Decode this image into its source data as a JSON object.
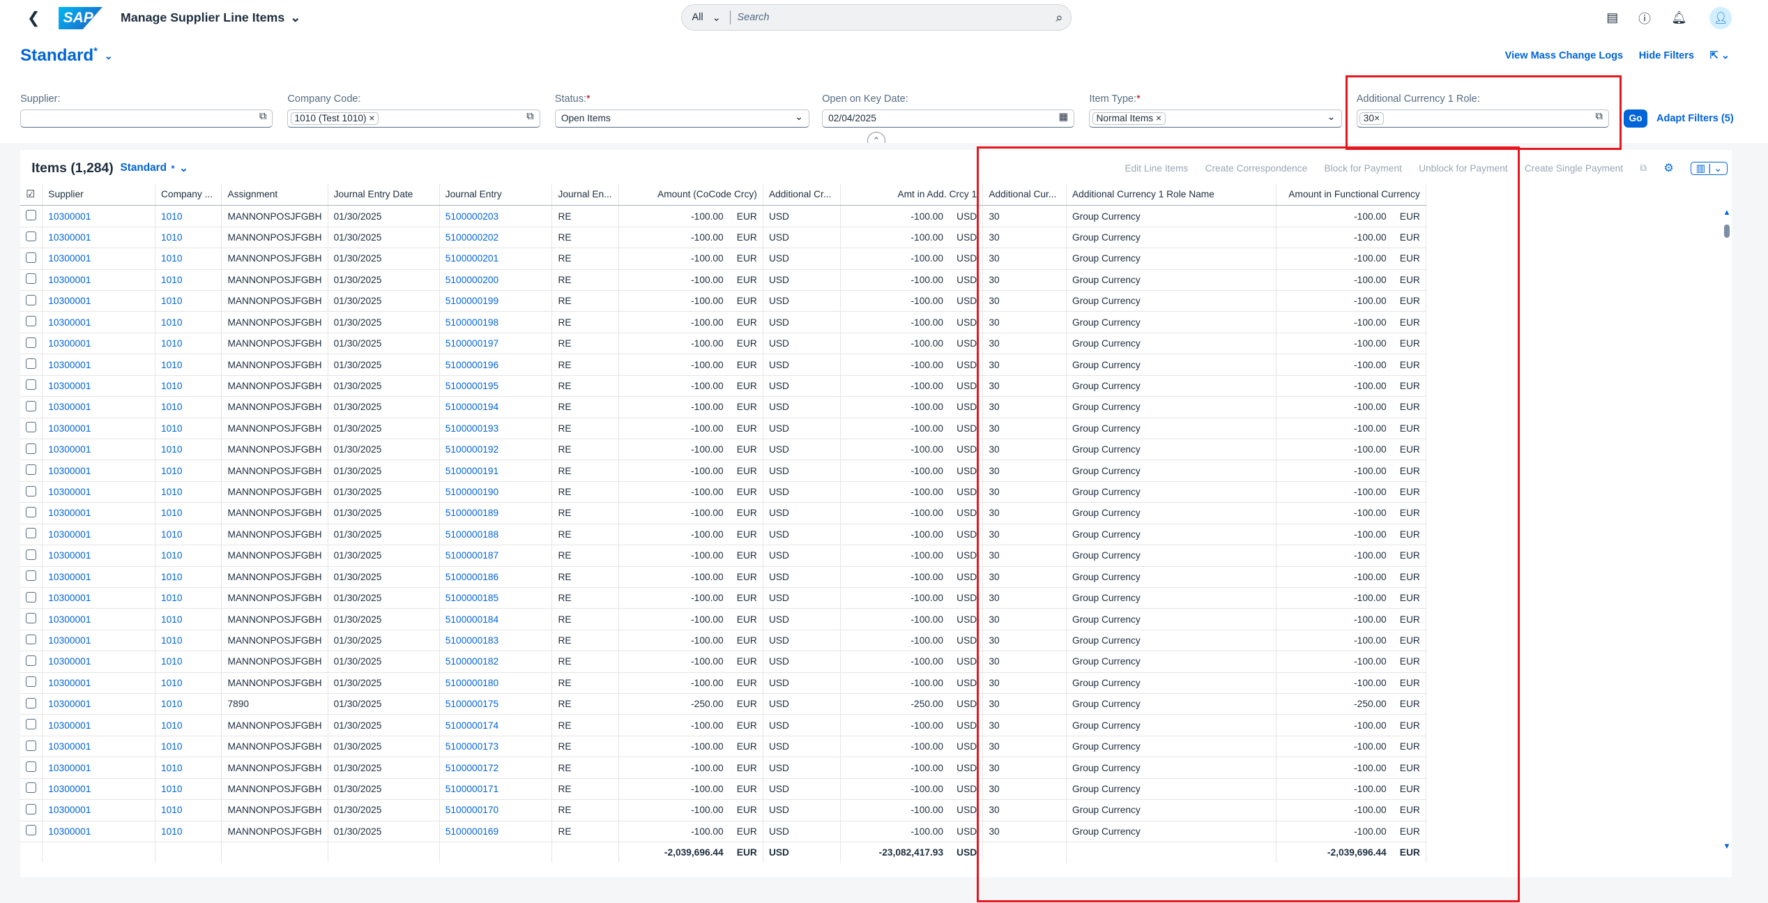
{
  "shell": {
    "app_title": "Manage Supplier Line Items",
    "search_scope": "All",
    "search_placeholder": "Search"
  },
  "page": {
    "variant": "Standard",
    "variant_marker": "*",
    "view_mass_change_logs": "View Mass Change Logs",
    "hide_filters": "Hide Filters"
  },
  "filters": {
    "supplier": {
      "label": "Supplier:",
      "value": ""
    },
    "company_code": {
      "label": "Company Code:",
      "token": "1010 (Test 1010)"
    },
    "status": {
      "label": "Status:",
      "required": "*",
      "value": "Open Items"
    },
    "open_on_key_date": {
      "label": "Open on Key Date:",
      "value": "02/04/2025"
    },
    "item_type": {
      "label": "Item Type:",
      "required": "*",
      "token": "Normal Items"
    },
    "add_currency_role": {
      "label": "Additional Currency 1 Role:",
      "token": "30"
    },
    "go": "Go",
    "adapt": "Adapt Filters (5)"
  },
  "table": {
    "title": "Items (1,284)",
    "variant": "Standard",
    "actions": [
      "Edit Line Items",
      "Create Correspondence",
      "Block for Payment",
      "Unblock for Payment",
      "Create Single Payment"
    ],
    "columns": [
      "Supplier",
      "Company ...",
      "Assignment",
      "Journal Entry Date",
      "Journal Entry",
      "Journal En...",
      "Amount (CoCode Crcy)",
      "Additional Cr...",
      "Amt in Add. Crcy 1",
      "Additional Cur...",
      "Additional Currency 1 Role Name",
      "Amount in Functional Currency"
    ],
    "rows": [
      [
        "10300001",
        "1010",
        "MANNONPOSJFGBH",
        "01/30/2025",
        "5100000203",
        "RE",
        "-100.00",
        "EUR",
        "USD",
        "-100.00",
        "USD",
        "30",
        "Group Currency",
        "-100.00",
        "EUR"
      ],
      [
        "10300001",
        "1010",
        "MANNONPOSJFGBH",
        "01/30/2025",
        "5100000202",
        "RE",
        "-100.00",
        "EUR",
        "USD",
        "-100.00",
        "USD",
        "30",
        "Group Currency",
        "-100.00",
        "EUR"
      ],
      [
        "10300001",
        "1010",
        "MANNONPOSJFGBH",
        "01/30/2025",
        "5100000201",
        "RE",
        "-100.00",
        "EUR",
        "USD",
        "-100.00",
        "USD",
        "30",
        "Group Currency",
        "-100.00",
        "EUR"
      ],
      [
        "10300001",
        "1010",
        "MANNONPOSJFGBH",
        "01/30/2025",
        "5100000200",
        "RE",
        "-100.00",
        "EUR",
        "USD",
        "-100.00",
        "USD",
        "30",
        "Group Currency",
        "-100.00",
        "EUR"
      ],
      [
        "10300001",
        "1010",
        "MANNONPOSJFGBH",
        "01/30/2025",
        "5100000199",
        "RE",
        "-100.00",
        "EUR",
        "USD",
        "-100.00",
        "USD",
        "30",
        "Group Currency",
        "-100.00",
        "EUR"
      ],
      [
        "10300001",
        "1010",
        "MANNONPOSJFGBH",
        "01/30/2025",
        "5100000198",
        "RE",
        "-100.00",
        "EUR",
        "USD",
        "-100.00",
        "USD",
        "30",
        "Group Currency",
        "-100.00",
        "EUR"
      ],
      [
        "10300001",
        "1010",
        "MANNONPOSJFGBH",
        "01/30/2025",
        "5100000197",
        "RE",
        "-100.00",
        "EUR",
        "USD",
        "-100.00",
        "USD",
        "30",
        "Group Currency",
        "-100.00",
        "EUR"
      ],
      [
        "10300001",
        "1010",
        "MANNONPOSJFGBH",
        "01/30/2025",
        "5100000196",
        "RE",
        "-100.00",
        "EUR",
        "USD",
        "-100.00",
        "USD",
        "30",
        "Group Currency",
        "-100.00",
        "EUR"
      ],
      [
        "10300001",
        "1010",
        "MANNONPOSJFGBH",
        "01/30/2025",
        "5100000195",
        "RE",
        "-100.00",
        "EUR",
        "USD",
        "-100.00",
        "USD",
        "30",
        "Group Currency",
        "-100.00",
        "EUR"
      ],
      [
        "10300001",
        "1010",
        "MANNONPOSJFGBH",
        "01/30/2025",
        "5100000194",
        "RE",
        "-100.00",
        "EUR",
        "USD",
        "-100.00",
        "USD",
        "30",
        "Group Currency",
        "-100.00",
        "EUR"
      ],
      [
        "10300001",
        "1010",
        "MANNONPOSJFGBH",
        "01/30/2025",
        "5100000193",
        "RE",
        "-100.00",
        "EUR",
        "USD",
        "-100.00",
        "USD",
        "30",
        "Group Currency",
        "-100.00",
        "EUR"
      ],
      [
        "10300001",
        "1010",
        "MANNONPOSJFGBH",
        "01/30/2025",
        "5100000192",
        "RE",
        "-100.00",
        "EUR",
        "USD",
        "-100.00",
        "USD",
        "30",
        "Group Currency",
        "-100.00",
        "EUR"
      ],
      [
        "10300001",
        "1010",
        "MANNONPOSJFGBH",
        "01/30/2025",
        "5100000191",
        "RE",
        "-100.00",
        "EUR",
        "USD",
        "-100.00",
        "USD",
        "30",
        "Group Currency",
        "-100.00",
        "EUR"
      ],
      [
        "10300001",
        "1010",
        "MANNONPOSJFGBH",
        "01/30/2025",
        "5100000190",
        "RE",
        "-100.00",
        "EUR",
        "USD",
        "-100.00",
        "USD",
        "30",
        "Group Currency",
        "-100.00",
        "EUR"
      ],
      [
        "10300001",
        "1010",
        "MANNONPOSJFGBH",
        "01/30/2025",
        "5100000189",
        "RE",
        "-100.00",
        "EUR",
        "USD",
        "-100.00",
        "USD",
        "30",
        "Group Currency",
        "-100.00",
        "EUR"
      ],
      [
        "10300001",
        "1010",
        "MANNONPOSJFGBH",
        "01/30/2025",
        "5100000188",
        "RE",
        "-100.00",
        "EUR",
        "USD",
        "-100.00",
        "USD",
        "30",
        "Group Currency",
        "-100.00",
        "EUR"
      ],
      [
        "10300001",
        "1010",
        "MANNONPOSJFGBH",
        "01/30/2025",
        "5100000187",
        "RE",
        "-100.00",
        "EUR",
        "USD",
        "-100.00",
        "USD",
        "30",
        "Group Currency",
        "-100.00",
        "EUR"
      ],
      [
        "10300001",
        "1010",
        "MANNONPOSJFGBH",
        "01/30/2025",
        "5100000186",
        "RE",
        "-100.00",
        "EUR",
        "USD",
        "-100.00",
        "USD",
        "30",
        "Group Currency",
        "-100.00",
        "EUR"
      ],
      [
        "10300001",
        "1010",
        "MANNONPOSJFGBH",
        "01/30/2025",
        "5100000185",
        "RE",
        "-100.00",
        "EUR",
        "USD",
        "-100.00",
        "USD",
        "30",
        "Group Currency",
        "-100.00",
        "EUR"
      ],
      [
        "10300001",
        "1010",
        "MANNONPOSJFGBH",
        "01/30/2025",
        "5100000184",
        "RE",
        "-100.00",
        "EUR",
        "USD",
        "-100.00",
        "USD",
        "30",
        "Group Currency",
        "-100.00",
        "EUR"
      ],
      [
        "10300001",
        "1010",
        "MANNONPOSJFGBH",
        "01/30/2025",
        "5100000183",
        "RE",
        "-100.00",
        "EUR",
        "USD",
        "-100.00",
        "USD",
        "30",
        "Group Currency",
        "-100.00",
        "EUR"
      ],
      [
        "10300001",
        "1010",
        "MANNONPOSJFGBH",
        "01/30/2025",
        "5100000182",
        "RE",
        "-100.00",
        "EUR",
        "USD",
        "-100.00",
        "USD",
        "30",
        "Group Currency",
        "-100.00",
        "EUR"
      ],
      [
        "10300001",
        "1010",
        "MANNONPOSJFGBH",
        "01/30/2025",
        "5100000180",
        "RE",
        "-100.00",
        "EUR",
        "USD",
        "-100.00",
        "USD",
        "30",
        "Group Currency",
        "-100.00",
        "EUR"
      ],
      [
        "10300001",
        "1010",
        "7890",
        "01/30/2025",
        "5100000175",
        "RE",
        "-250.00",
        "EUR",
        "USD",
        "-250.00",
        "USD",
        "30",
        "Group Currency",
        "-250.00",
        "EUR"
      ],
      [
        "10300001",
        "1010",
        "MANNONPOSJFGBH",
        "01/30/2025",
        "5100000174",
        "RE",
        "-100.00",
        "EUR",
        "USD",
        "-100.00",
        "USD",
        "30",
        "Group Currency",
        "-100.00",
        "EUR"
      ],
      [
        "10300001",
        "1010",
        "MANNONPOSJFGBH",
        "01/30/2025",
        "5100000173",
        "RE",
        "-100.00",
        "EUR",
        "USD",
        "-100.00",
        "USD",
        "30",
        "Group Currency",
        "-100.00",
        "EUR"
      ],
      [
        "10300001",
        "1010",
        "MANNONPOSJFGBH",
        "01/30/2025",
        "5100000172",
        "RE",
        "-100.00",
        "EUR",
        "USD",
        "-100.00",
        "USD",
        "30",
        "Group Currency",
        "-100.00",
        "EUR"
      ],
      [
        "10300001",
        "1010",
        "MANNONPOSJFGBH",
        "01/30/2025",
        "5100000171",
        "RE",
        "-100.00",
        "EUR",
        "USD",
        "-100.00",
        "USD",
        "30",
        "Group Currency",
        "-100.00",
        "EUR"
      ],
      [
        "10300001",
        "1010",
        "MANNONPOSJFGBH",
        "01/30/2025",
        "5100000170",
        "RE",
        "-100.00",
        "EUR",
        "USD",
        "-100.00",
        "USD",
        "30",
        "Group Currency",
        "-100.00",
        "EUR"
      ],
      [
        "10300001",
        "1010",
        "MANNONPOSJFGBH",
        "01/30/2025",
        "5100000169",
        "RE",
        "-100.00",
        "EUR",
        "USD",
        "-100.00",
        "USD",
        "30",
        "Group Currency",
        "-100.00",
        "EUR"
      ]
    ],
    "totals": {
      "amount_cocode": "-2,039,696.44",
      "cocode_currency": "EUR",
      "add_currency": "USD",
      "amt_add_crcy": "-23,082,417.93",
      "amt_add_unit": "USD",
      "amount_functional": "-2,039,696.44",
      "functional_currency": "EUR"
    }
  },
  "colors": {
    "accent": "#0064d9",
    "highlight": "#e6161f"
  }
}
